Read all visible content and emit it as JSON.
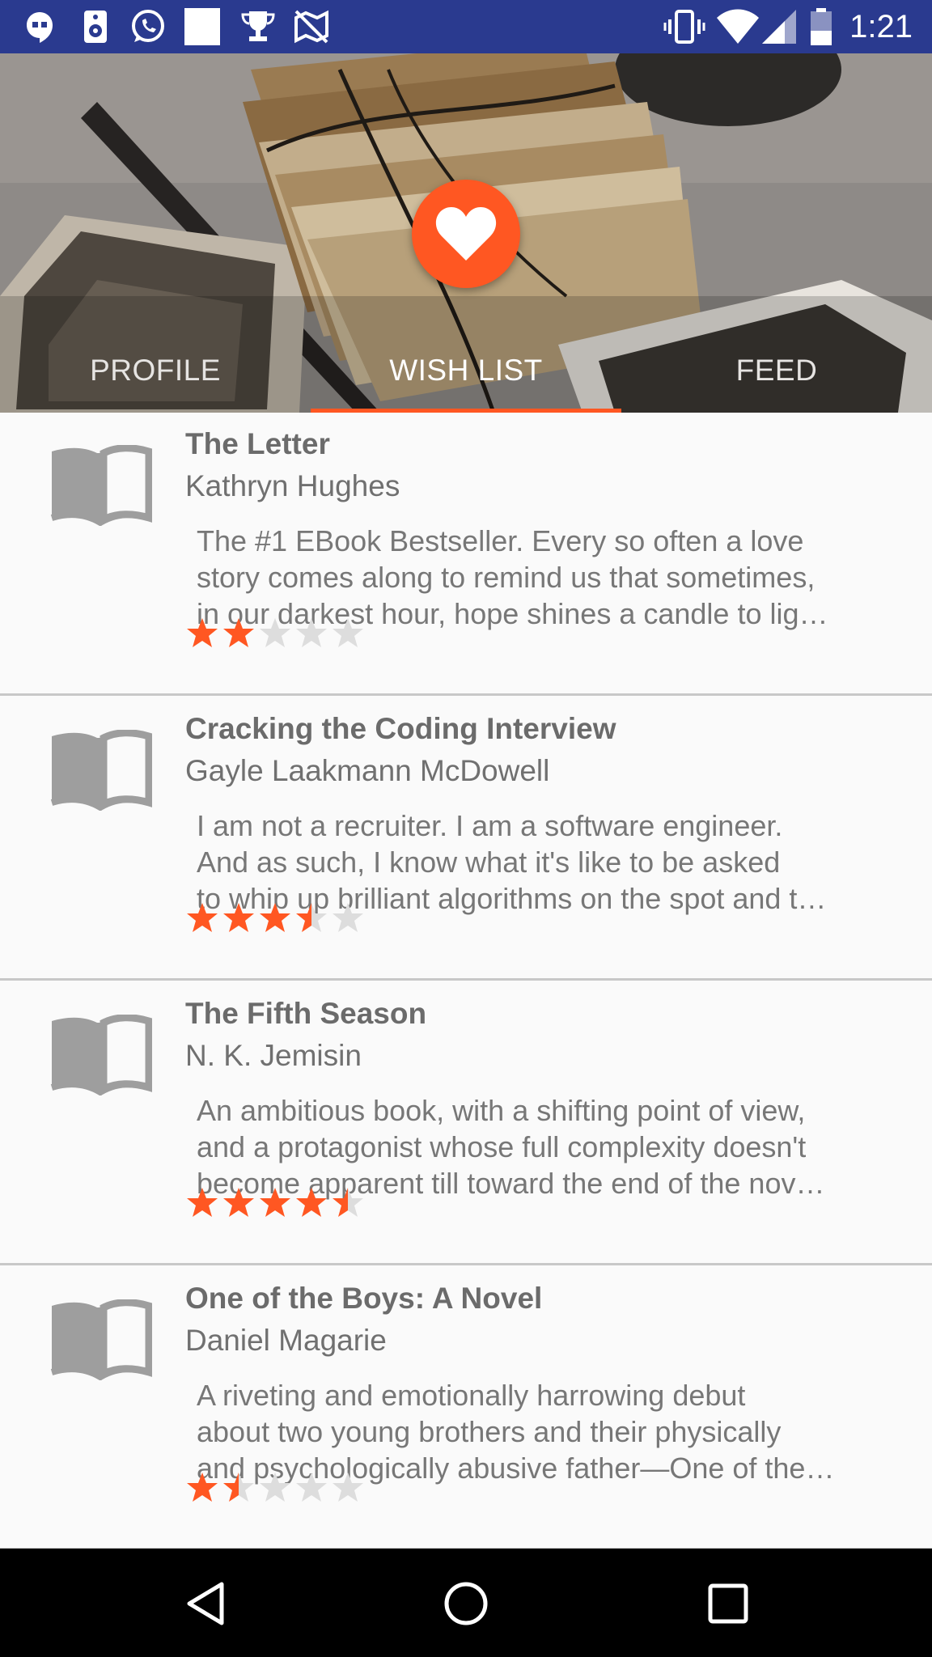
{
  "status_bar": {
    "time": "1:21",
    "left_icons": [
      "hangouts-icon",
      "speaker-icon",
      "whatsapp-icon",
      "blank-square-icon",
      "trophy-icon",
      "map-off-icon"
    ],
    "right_icons": [
      "vibrate-icon",
      "wifi-icon",
      "signal-icon",
      "battery-icon"
    ]
  },
  "header": {
    "fab_icon": "heart-icon",
    "accent_color": "#ff5722",
    "tabs": [
      {
        "label": "PROFILE",
        "active": false
      },
      {
        "label": "WISH LIST",
        "active": true
      },
      {
        "label": "FEED",
        "active": false
      }
    ]
  },
  "books": [
    {
      "title": "The Letter",
      "author": "Kathryn Hughes",
      "desc_lines": [
        "The #1 EBook Bestseller. Every so often a love",
        "story comes along to remind us that sometimes,",
        "in our darkest hour, hope shines a candle to lig…"
      ],
      "rating": 2
    },
    {
      "title": "Cracking the Coding Interview",
      "author": "Gayle Laakmann McDowell",
      "desc_lines": [
        "I am not a recruiter. I am a software engineer.",
        "And as such, I know what it's like to be asked",
        "to whip up brilliant algorithms on the spot and t…"
      ],
      "rating": 3.5
    },
    {
      "title": "The Fifth Season",
      "author": " N. K. Jemisin",
      "desc_lines": [
        "An ambitious book, with a shifting point of view,",
        "and a protagonist whose full complexity doesn't",
        "become apparent till toward the end of the nov…"
      ],
      "rating": 4.5
    },
    {
      "title": "One of the Boys: A Novel",
      "author": "Daniel Magarie",
      "desc_lines": [
        "A riveting and emotionally harrowing debut",
        "about two young brothers and their physically",
        "and psychologically abusive father—One of the…"
      ],
      "rating": 1.5
    }
  ],
  "navbar": {
    "buttons": [
      "back-icon",
      "home-icon",
      "recents-icon"
    ]
  }
}
